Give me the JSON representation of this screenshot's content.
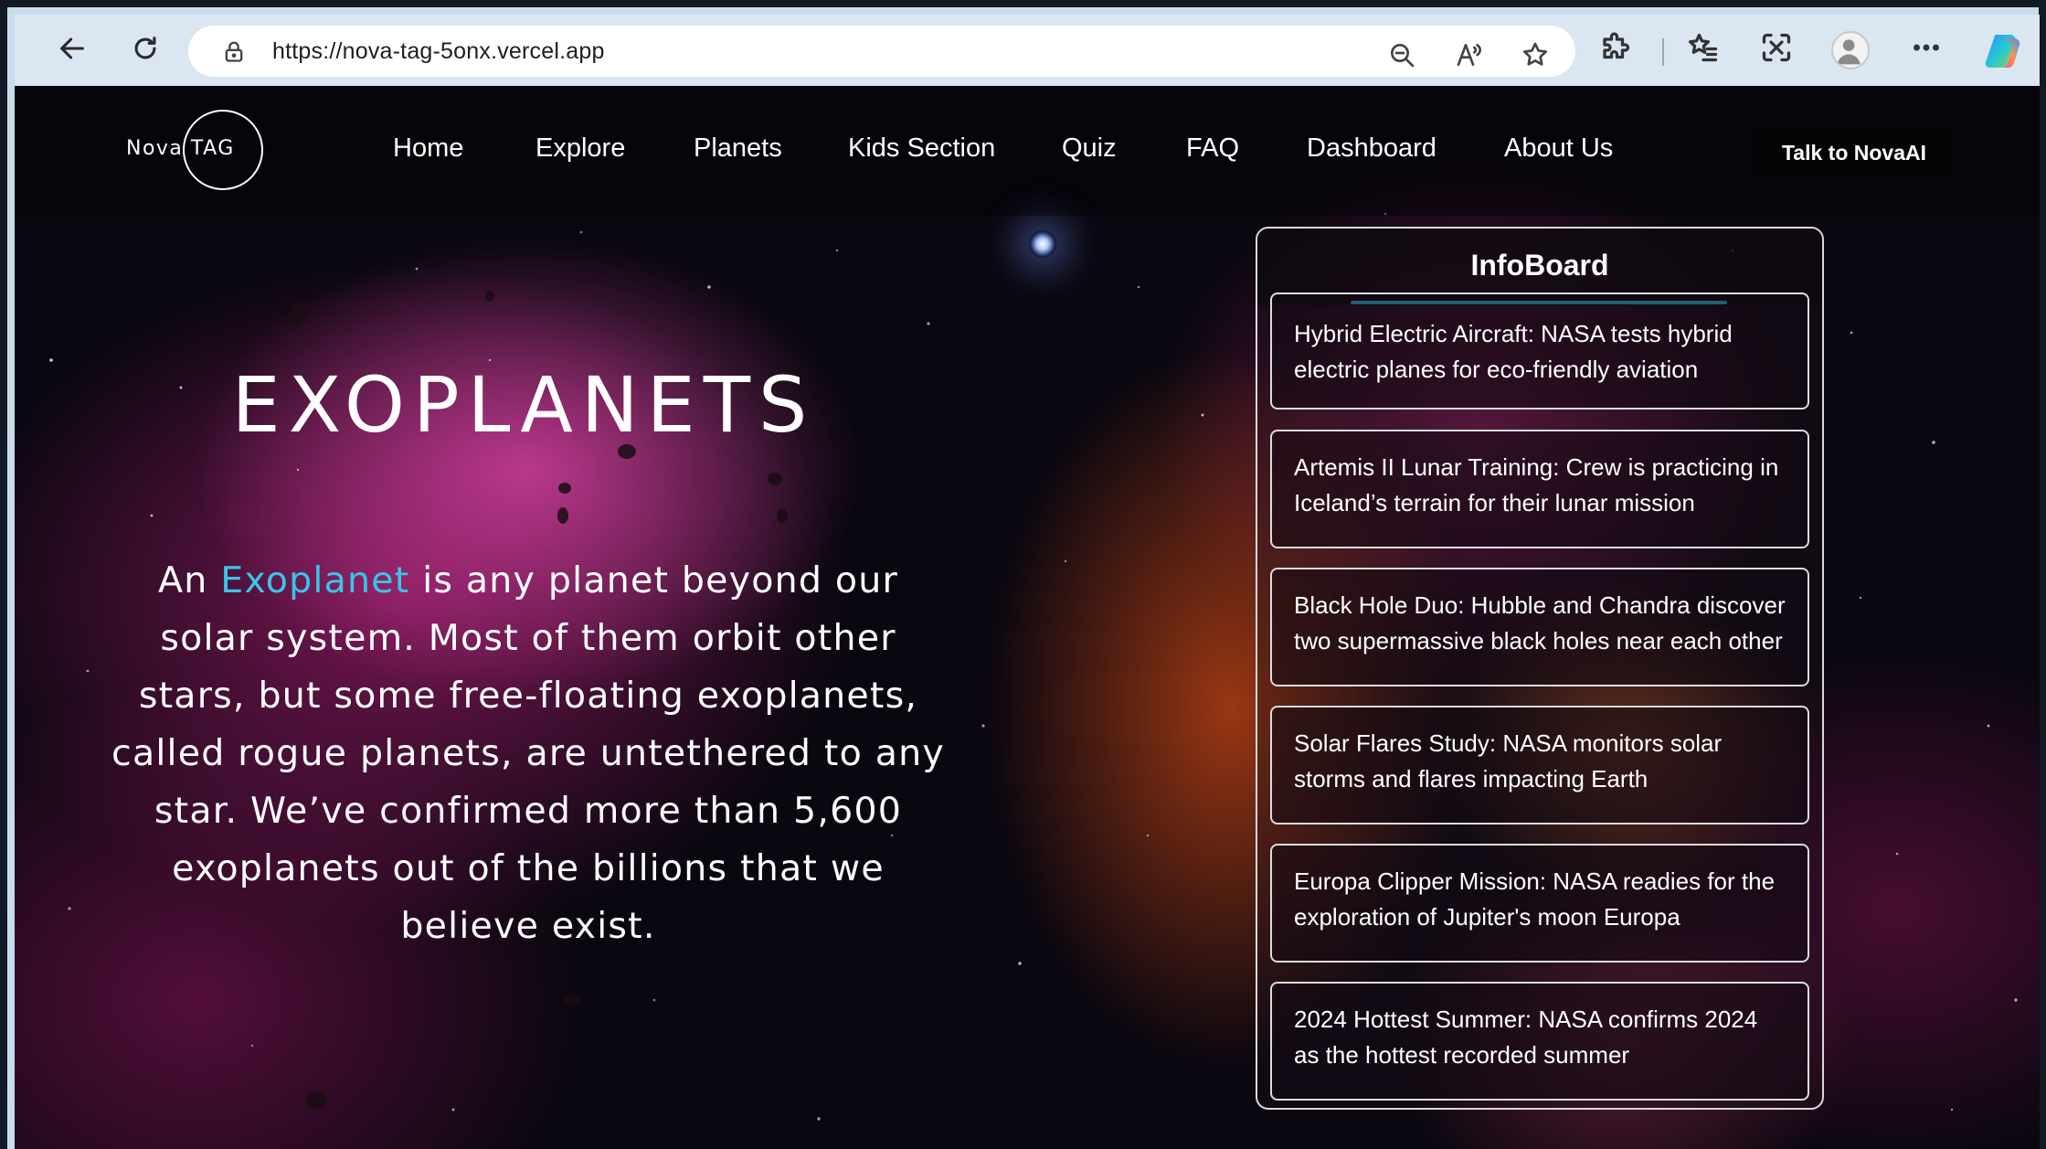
{
  "browser": {
    "url": "https://nova-tag-5onx.vercel.app"
  },
  "site": {
    "logo_text": "Nova TAG",
    "nav": [
      {
        "label": "Home"
      },
      {
        "label": "Explore"
      },
      {
        "label": "Planets"
      },
      {
        "label": "Kids Section"
      },
      {
        "label": "Quiz"
      },
      {
        "label": "FAQ"
      },
      {
        "label": "Dashboard"
      },
      {
        "label": "About Us"
      }
    ],
    "cta_label": "Talk to NovaAI"
  },
  "hero": {
    "title": "EXOPLANETS",
    "text_prefix": "An ",
    "text_highlight": "Exoplanet",
    "text_body": " is any planet beyond our solar system. Most of them orbit other stars, but some free-floating exoplanets, called rogue planets, are untethered to any star. We’ve confirmed more than 5,600 exoplanets out of the billions that we believe exist."
  },
  "infoboard": {
    "title": "InfoBoard",
    "items": [
      {
        "text": "Hybrid Electric Aircraft: NASA tests hybrid electric planes for eco-friendly aviation"
      },
      {
        "text": "Artemis II Lunar Training: Crew is practicing in Iceland’s terrain for their lunar mission"
      },
      {
        "text": "Black Hole Duo: Hubble and Chandra discover two supermassive black holes near each other"
      },
      {
        "text": "Solar Flares Study: NASA monitors solar storms and flares impacting Earth"
      },
      {
        "text": "Europa Clipper Mission: NASA readies for the exploration of Jupiter's moon Europa"
      },
      {
        "text": "2024 Hottest Summer: NASA confirms 2024 as the hottest recorded summer"
      }
    ]
  },
  "colors": {
    "accent": "#2ec8e6",
    "highlight": "#38c6e8",
    "chrome_bg": "#dbe6f3",
    "cta_bg": "#050507"
  },
  "icons": {
    "back": "arrow-left-icon",
    "refresh": "refresh-icon",
    "lock": "lock-icon",
    "zoom": "zoom-out-icon",
    "read_aloud": "read-aloud-icon",
    "favorite": "star-icon",
    "extensions": "puzzle-icon",
    "favorites": "favorites-list-icon",
    "screenshot": "screenshot-icon",
    "profile": "profile-icon",
    "more": "more-icon",
    "copilot": "copilot-icon"
  }
}
